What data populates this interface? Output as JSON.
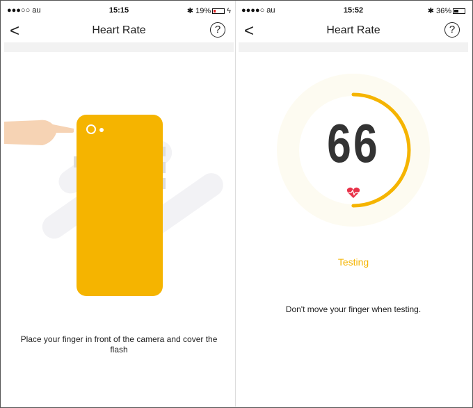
{
  "left": {
    "status": {
      "carrier": "●●●○○ au",
      "time": "15:15",
      "battery": "19%",
      "battery_level": 0.19,
      "battery_color": "#e02020"
    },
    "nav": {
      "title": "Heart Rate",
      "back": "<",
      "help": "?"
    },
    "instruction": "Place your finger in front of the camera and cover the flash"
  },
  "right": {
    "status": {
      "carrier": "●●●●○ au",
      "time": "15:52",
      "battery": "36%",
      "battery_level": 0.36,
      "battery_color": "#111111"
    },
    "nav": {
      "title": "Heart Rate",
      "back": "<",
      "help": "?"
    },
    "heart_rate": "66",
    "progress": 0.5,
    "state": "Testing",
    "instruction": "Don't move your finger when testing."
  },
  "colors": {
    "accent": "#f5b400",
    "heart": "#e8334a"
  }
}
